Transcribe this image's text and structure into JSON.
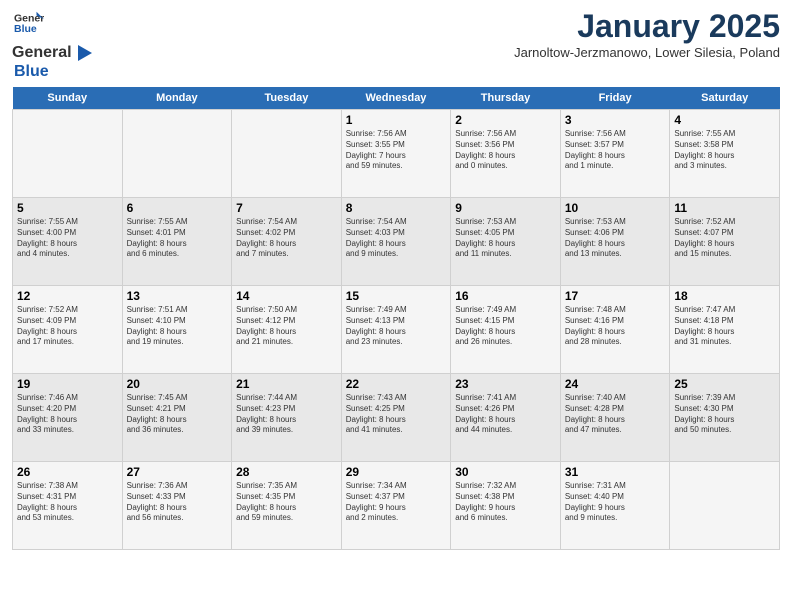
{
  "header": {
    "logo_general": "General",
    "logo_blue": "Blue",
    "month_title": "January 2025",
    "location": "Jarnoltow-Jerzmanowo, Lower Silesia, Poland"
  },
  "days_of_week": [
    "Sunday",
    "Monday",
    "Tuesday",
    "Wednesday",
    "Thursday",
    "Friday",
    "Saturday"
  ],
  "weeks": [
    {
      "days": [
        {
          "num": "",
          "info": ""
        },
        {
          "num": "",
          "info": ""
        },
        {
          "num": "",
          "info": ""
        },
        {
          "num": "1",
          "info": "Sunrise: 7:56 AM\nSunset: 3:55 PM\nDaylight: 7 hours\nand 59 minutes."
        },
        {
          "num": "2",
          "info": "Sunrise: 7:56 AM\nSunset: 3:56 PM\nDaylight: 8 hours\nand 0 minutes."
        },
        {
          "num": "3",
          "info": "Sunrise: 7:56 AM\nSunset: 3:57 PM\nDaylight: 8 hours\nand 1 minute."
        },
        {
          "num": "4",
          "info": "Sunrise: 7:55 AM\nSunset: 3:58 PM\nDaylight: 8 hours\nand 3 minutes."
        }
      ]
    },
    {
      "days": [
        {
          "num": "5",
          "info": "Sunrise: 7:55 AM\nSunset: 4:00 PM\nDaylight: 8 hours\nand 4 minutes."
        },
        {
          "num": "6",
          "info": "Sunrise: 7:55 AM\nSunset: 4:01 PM\nDaylight: 8 hours\nand 6 minutes."
        },
        {
          "num": "7",
          "info": "Sunrise: 7:54 AM\nSunset: 4:02 PM\nDaylight: 8 hours\nand 7 minutes."
        },
        {
          "num": "8",
          "info": "Sunrise: 7:54 AM\nSunset: 4:03 PM\nDaylight: 8 hours\nand 9 minutes."
        },
        {
          "num": "9",
          "info": "Sunrise: 7:53 AM\nSunset: 4:05 PM\nDaylight: 8 hours\nand 11 minutes."
        },
        {
          "num": "10",
          "info": "Sunrise: 7:53 AM\nSunset: 4:06 PM\nDaylight: 8 hours\nand 13 minutes."
        },
        {
          "num": "11",
          "info": "Sunrise: 7:52 AM\nSunset: 4:07 PM\nDaylight: 8 hours\nand 15 minutes."
        }
      ]
    },
    {
      "days": [
        {
          "num": "12",
          "info": "Sunrise: 7:52 AM\nSunset: 4:09 PM\nDaylight: 8 hours\nand 17 minutes."
        },
        {
          "num": "13",
          "info": "Sunrise: 7:51 AM\nSunset: 4:10 PM\nDaylight: 8 hours\nand 19 minutes."
        },
        {
          "num": "14",
          "info": "Sunrise: 7:50 AM\nSunset: 4:12 PM\nDaylight: 8 hours\nand 21 minutes."
        },
        {
          "num": "15",
          "info": "Sunrise: 7:49 AM\nSunset: 4:13 PM\nDaylight: 8 hours\nand 23 minutes."
        },
        {
          "num": "16",
          "info": "Sunrise: 7:49 AM\nSunset: 4:15 PM\nDaylight: 8 hours\nand 26 minutes."
        },
        {
          "num": "17",
          "info": "Sunrise: 7:48 AM\nSunset: 4:16 PM\nDaylight: 8 hours\nand 28 minutes."
        },
        {
          "num": "18",
          "info": "Sunrise: 7:47 AM\nSunset: 4:18 PM\nDaylight: 8 hours\nand 31 minutes."
        }
      ]
    },
    {
      "days": [
        {
          "num": "19",
          "info": "Sunrise: 7:46 AM\nSunset: 4:20 PM\nDaylight: 8 hours\nand 33 minutes."
        },
        {
          "num": "20",
          "info": "Sunrise: 7:45 AM\nSunset: 4:21 PM\nDaylight: 8 hours\nand 36 minutes."
        },
        {
          "num": "21",
          "info": "Sunrise: 7:44 AM\nSunset: 4:23 PM\nDaylight: 8 hours\nand 39 minutes."
        },
        {
          "num": "22",
          "info": "Sunrise: 7:43 AM\nSunset: 4:25 PM\nDaylight: 8 hours\nand 41 minutes."
        },
        {
          "num": "23",
          "info": "Sunrise: 7:41 AM\nSunset: 4:26 PM\nDaylight: 8 hours\nand 44 minutes."
        },
        {
          "num": "24",
          "info": "Sunrise: 7:40 AM\nSunset: 4:28 PM\nDaylight: 8 hours\nand 47 minutes."
        },
        {
          "num": "25",
          "info": "Sunrise: 7:39 AM\nSunset: 4:30 PM\nDaylight: 8 hours\nand 50 minutes."
        }
      ]
    },
    {
      "days": [
        {
          "num": "26",
          "info": "Sunrise: 7:38 AM\nSunset: 4:31 PM\nDaylight: 8 hours\nand 53 minutes."
        },
        {
          "num": "27",
          "info": "Sunrise: 7:36 AM\nSunset: 4:33 PM\nDaylight: 8 hours\nand 56 minutes."
        },
        {
          "num": "28",
          "info": "Sunrise: 7:35 AM\nSunset: 4:35 PM\nDaylight: 8 hours\nand 59 minutes."
        },
        {
          "num": "29",
          "info": "Sunrise: 7:34 AM\nSunset: 4:37 PM\nDaylight: 9 hours\nand 2 minutes."
        },
        {
          "num": "30",
          "info": "Sunrise: 7:32 AM\nSunset: 4:38 PM\nDaylight: 9 hours\nand 6 minutes."
        },
        {
          "num": "31",
          "info": "Sunrise: 7:31 AM\nSunset: 4:40 PM\nDaylight: 9 hours\nand 9 minutes."
        },
        {
          "num": "",
          "info": ""
        }
      ]
    }
  ]
}
